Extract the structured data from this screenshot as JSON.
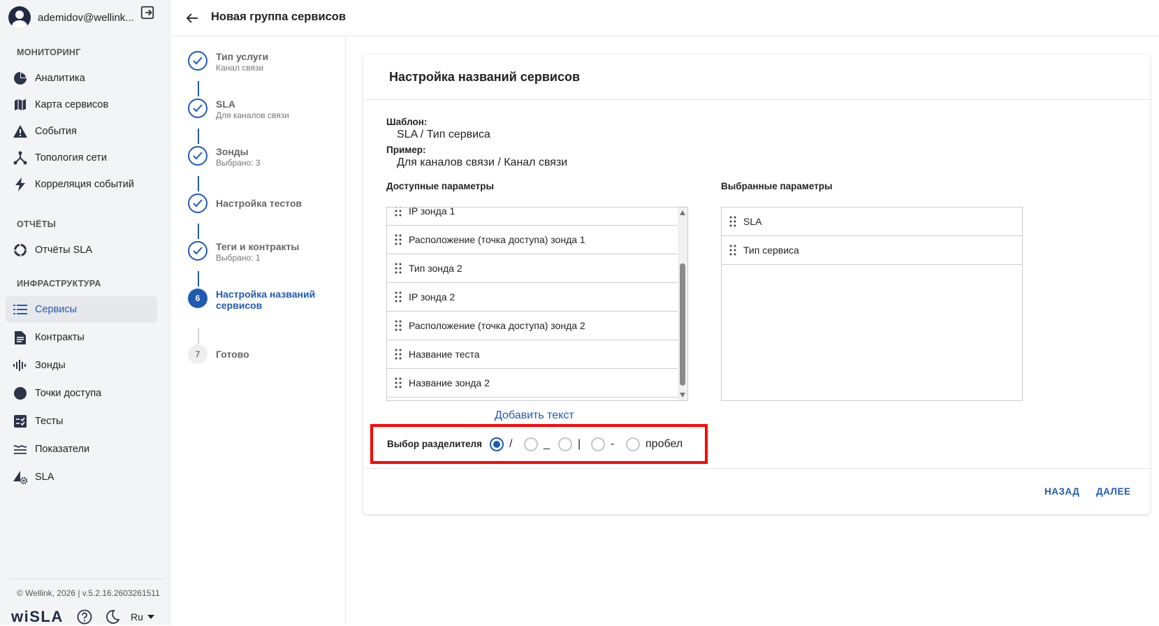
{
  "user": {
    "name": "ademidov@wellink..."
  },
  "sidebar": {
    "sections": [
      {
        "title": "МОНИТОРИНГ"
      },
      {
        "title": "ОТЧЁТЫ"
      },
      {
        "title": "ИНФРАСТРУКТУРА"
      }
    ],
    "items": [
      {
        "label": "Аналитика",
        "icon": "pie-chart-icon"
      },
      {
        "label": "Карта сервисов",
        "icon": "map-icon"
      },
      {
        "label": "События",
        "icon": "warning-icon"
      },
      {
        "label": "Топология сети",
        "icon": "topology-icon"
      },
      {
        "label": "Корреляция событий",
        "icon": "lightning-icon"
      },
      {
        "label": "Отчёты SLA",
        "icon": "report-ring-icon"
      },
      {
        "label": "Сервисы",
        "icon": "list-icon",
        "active": true
      },
      {
        "label": "Контракты",
        "icon": "document-icon"
      },
      {
        "label": "Зонды",
        "icon": "probe-icon"
      },
      {
        "label": "Точки доступа",
        "icon": "circle-icon"
      },
      {
        "label": "Тесты",
        "icon": "checklist-icon"
      },
      {
        "label": "Показатели",
        "icon": "metrics-icon"
      },
      {
        "label": "SLA",
        "icon": "sla-gear-icon"
      }
    ],
    "footer": {
      "copyright": "© Wellink, 2026 | v.5.2.16.2603261511",
      "logo": "wiSLA",
      "language": "Ru"
    }
  },
  "header": {
    "title": "Новая группа сервисов"
  },
  "stepper": {
    "steps": [
      {
        "title": "Тип услуги",
        "subtitle": "Канал связи",
        "state": "done"
      },
      {
        "title": "SLA",
        "subtitle": "Для каналов связи",
        "state": "done"
      },
      {
        "title": "Зонды",
        "subtitle": "Выбрано: 3",
        "state": "done"
      },
      {
        "title": "Настройка тестов",
        "subtitle": "",
        "state": "done"
      },
      {
        "title": "Теги и контракты",
        "subtitle": "Выбрано: 1",
        "state": "done"
      },
      {
        "number": "6",
        "title": "Настройка названий сервисов",
        "subtitle": "",
        "state": "current"
      },
      {
        "number": "7",
        "title": "Готово",
        "subtitle": "",
        "state": "todo"
      }
    ]
  },
  "card": {
    "title": "Настройка названий сервисов",
    "template_label": "Шаблон:",
    "template_value": "SLA / Тип сервиса",
    "example_label": "Пример:",
    "example_value": "Для каналов связи / Канал связи",
    "available_title": "Доступные параметры",
    "selected_title": "Выбранные параметры",
    "available": [
      "IP зонда 1",
      "Расположение (точка доступа) зонда 1",
      "Тип зонда 2",
      "IP зонда 2",
      "Расположение (точка доступа) зонда 2",
      "Название теста",
      "Название зонда 2"
    ],
    "selected": [
      "SLA",
      "Тип сервиса"
    ],
    "add_text": "Добавить текст",
    "separator_label": "Выбор разделителя",
    "separators": [
      {
        "label": "/",
        "checked": true
      },
      {
        "label": "_",
        "checked": false
      },
      {
        "label": "|",
        "checked": false
      },
      {
        "label": "-",
        "checked": false
      },
      {
        "label": "пробел",
        "checked": false
      }
    ],
    "back_label": "НАЗАД",
    "next_label": "ДАЛЕЕ"
  },
  "colors": {
    "accent": "#1f5bb3",
    "highlight": "#ff0000",
    "sidebar_bg": "#f3f4f6"
  }
}
